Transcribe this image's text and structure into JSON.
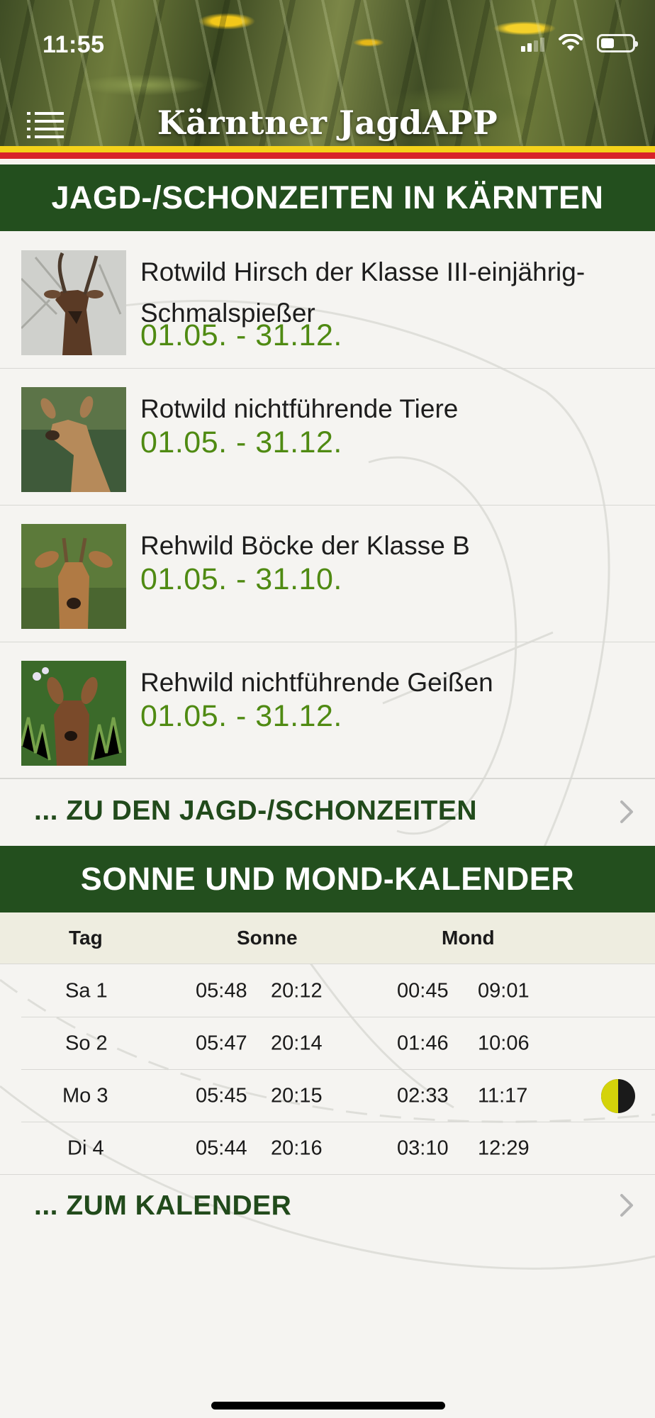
{
  "status_bar": {
    "time": "11:55"
  },
  "header": {
    "title": "Kärntner JagdAPP"
  },
  "hunting": {
    "heading": "JAGD-/SCHONZEITEN IN KÄRNTEN",
    "items": [
      {
        "name": "Rotwild Hirsch der Klasse III-einjährig-Schmalspießer",
        "dates": "01.05. - 31.12."
      },
      {
        "name": "Rotwild nichtführende Tiere",
        "dates": "01.05. - 31.12."
      },
      {
        "name": "Rehwild Böcke der Klasse B",
        "dates": "01.05. - 31.10."
      },
      {
        "name": "Rehwild nichtführende Geißen",
        "dates": "01.05. - 31.12."
      }
    ],
    "more_label": "... ZU DEN JAGD-/SCHONZEITEN"
  },
  "calendar": {
    "heading": "SONNE UND MOND-KALENDER",
    "columns": {
      "day": "Tag",
      "sun": "Sonne",
      "moon": "Mond"
    },
    "rows": [
      {
        "day": "Sa 1",
        "sunrise": "05:48",
        "sunset": "20:12",
        "moonrise": "00:45",
        "moonset": "09:01"
      },
      {
        "day": "So 2",
        "sunrise": "05:47",
        "sunset": "20:14",
        "moonrise": "01:46",
        "moonset": "10:06"
      },
      {
        "day": "Mo 3",
        "sunrise": "05:45",
        "sunset": "20:15",
        "moonrise": "02:33",
        "moonset": "11:17",
        "phase_icon": "half-moon-icon"
      },
      {
        "day": "Di 4",
        "sunrise": "05:44",
        "sunset": "20:16",
        "moonrise": "03:10",
        "moonset": "12:29"
      }
    ],
    "more_label": "... ZUM KALENDER"
  },
  "colors": {
    "banner_green": "#234f1e",
    "date_green": "#4f8a12",
    "link_green": "#214a1b",
    "flag_yellow": "#f4d21a",
    "flag_red": "#d8232a",
    "moon_yellow": "#d4d30a"
  }
}
